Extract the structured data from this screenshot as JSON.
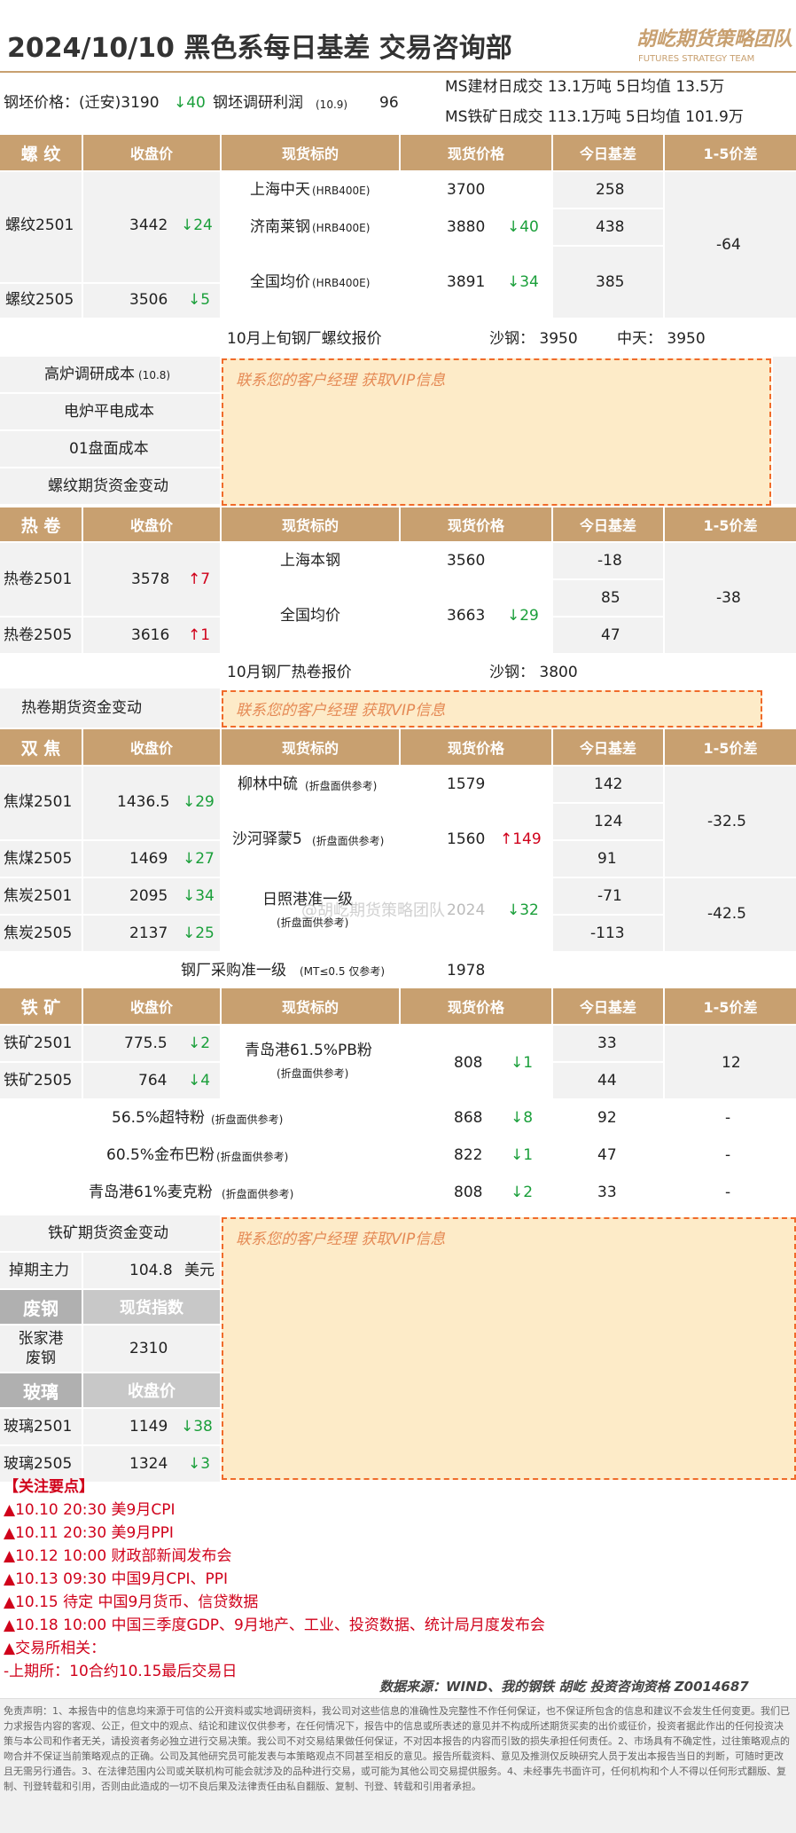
{
  "header": {
    "title": "2024/10/10  黑色系每日基差    交易咨询部",
    "logo_cn": "胡屹期货策略团队",
    "logo_en": "FUTURES STRATEGY TEAM"
  },
  "topinfo": {
    "billet_label": "钢坯价格：(迁安)3190",
    "billet_chg": "↓40",
    "profit_label": "钢坯调研利润",
    "profit_date": "(10.9)",
    "profit_val": "96",
    "ms1": "MS建材日成交  13.1万吨    5日均值  13.5万",
    "ms2": "MS铁矿日成交  113.1万吨   5日均值 101.9万"
  },
  "cols": {
    "close": "收盘价",
    "spot": "现货标的",
    "spot_price": "现货价格",
    "basis": "今日基差",
    "spread": "1-5价差"
  },
  "rebar": {
    "head": "螺 纹",
    "r1": {
      "name": "螺纹2501",
      "close": "3442",
      "chg": "↓24"
    },
    "r2": {
      "name": "螺纹2505",
      "close": "3506",
      "chg": "↓5"
    },
    "s1": {
      "name": "上海中天",
      "spec": "(HRB400E)",
      "price": "3700",
      "chg": "",
      "basis": "258"
    },
    "s2": {
      "name": "济南莱钢",
      "spec": "(HRB400E)",
      "price": "3880",
      "chg": "↓40",
      "basis": "438"
    },
    "s3": {
      "name": "全国均价",
      "spec": "(HRB400E)",
      "price": "3891",
      "chg": "↓34",
      "basis": "385"
    },
    "spread": "-64",
    "quote_title": "10月上旬钢厂螺纹报价",
    "q1": "沙钢：  3950",
    "q2": "中天：  3950"
  },
  "rebar_cost": {
    "c1": "高炉调研成本",
    "c1d": "(10.8)",
    "c2": "电炉平电成本",
    "c3": "01盘面成本",
    "c4": "螺纹期货资金变动"
  },
  "vip": "联系您的客户经理     获取VIP信息",
  "hrc": {
    "head": "热 卷",
    "r1": {
      "name": "热卷2501",
      "close": "3578",
      "chg": "↑7"
    },
    "r2": {
      "name": "热卷2505",
      "close": "3616",
      "chg": "↑1"
    },
    "s1": {
      "name": "上海本钢",
      "price": "3560",
      "basis": "-18"
    },
    "basis2": "85",
    "s2": {
      "name": "全国均价",
      "price": "3663",
      "chg": "↓29",
      "basis": "47"
    },
    "spread": "-38",
    "quote_title": "10月钢厂热卷报价",
    "q1": "沙钢：  3800",
    "flow": "热卷期货资金变动"
  },
  "coke": {
    "head": "双 焦",
    "r1": {
      "name": "焦煤2501",
      "close": "1436.5",
      "chg": "↓29"
    },
    "r2": {
      "name": "焦煤2505",
      "close": "1469",
      "chg": "↓27"
    },
    "r3": {
      "name": "焦炭2501",
      "close": "2095",
      "chg": "↓34"
    },
    "r4": {
      "name": "焦炭2505",
      "close": "2137",
      "chg": "↓25"
    },
    "s1": {
      "name": "柳林中硫",
      "note": "(折盘面供参考)",
      "price": "1579",
      "basis": "142"
    },
    "s2": {
      "name": "沙河驿蒙5",
      "note": "(折盘面供参考)",
      "price": "1560",
      "chg": "↑149",
      "basis1": "124",
      "basis2": "91"
    },
    "s3": {
      "name": "日照港准一级",
      "note": "(折盘面供参考)",
      "price": "2024",
      "chg": "↓32",
      "basis1": "-71",
      "basis2": "-113"
    },
    "spread1": "-32.5",
    "spread2": "-42.5",
    "mill": "钢厂采购准一级",
    "mill_note": "(MT≤0.5 仅参考)",
    "mill_price": "1978",
    "watermark": "@胡屹期货策略团队"
  },
  "ore": {
    "head": "铁 矿",
    "r1": {
      "name": "铁矿2501",
      "close": "775.5",
      "chg": "↓2"
    },
    "r2": {
      "name": "铁矿2505",
      "close": "764",
      "chg": "↓4"
    },
    "s1": {
      "name": "青岛港61.5%PB粉",
      "note": "(折盘面供参考)",
      "price": "808",
      "chg": "↓1",
      "basis1": "33",
      "basis2": "44"
    },
    "spread": "12",
    "e1": {
      "name": "56.5%超特粉",
      "note": "(折盘面供参考)",
      "price": "868",
      "chg": "↓8",
      "basis": "92",
      "spread": "-"
    },
    "e2": {
      "name": "60.5%金布巴粉",
      "note": "(折盘面供参考)",
      "price": "822",
      "chg": "↓1",
      "basis": "47",
      "spread": "-"
    },
    "e3": {
      "name": "青岛港61%麦克粉",
      "note": "(折盘面供参考)",
      "price": "808",
      "chg": "↓2",
      "basis": "33",
      "spread": "-"
    },
    "flow": "铁矿期货资金变动",
    "swap_label": "掉期主力",
    "swap_val": "104.8",
    "swap_unit": "美元"
  },
  "scrap": {
    "head": "废钢",
    "col": "现货指数",
    "name": "张家港废钢",
    "val": "2310"
  },
  "glass": {
    "head": "玻璃",
    "col": "收盘价",
    "r1": {
      "name": "玻璃2501",
      "close": "1149",
      "chg": "↓38"
    },
    "r2": {
      "name": "玻璃2505",
      "close": "1324",
      "chg": "↓3"
    }
  },
  "focus": {
    "title": "【关注要点】",
    "items": [
      "▲10.10 20:30 美9月CPI",
      "▲10.11 20:30 美9月PPI",
      "▲10.12 10:00 财政部新闻发布会",
      "▲10.13 09:30 中国9月CPI、PPI",
      "▲10.15 待定 中国9月货币、信贷数据",
      "▲10.18 10:00 中国三季度GDP、9月地产、工业、投资数据、统计局月度发布会",
      "▲交易所相关：",
      "-上期所：10合约10.15最后交易日"
    ]
  },
  "source": "数据来源：WIND、我的钢铁      胡屹  投资咨询资格 Z0014687",
  "disclaimer": "免责声明：1、本报告中的信息均来源于可信的公开资料或实地调研资料，我公司对这些信息的准确性及完整性不作任何保证，也不保证所包含的信息和建议不会发生任何变更。我们已力求报告内容的客观、公正，但文中的观点、结论和建议仅供参考，在任何情况下，报告中的信息或所表述的意见并不构成所述期货买卖的出价或征价，投资者据此作出的任何投资决策与本公司和作者无关，请投资者务必独立进行交易决策。我公司不对交易结果做任何保证，不对因本报告的内容而引致的损失承担任何责任。2、市场具有不确定性，过往策略观点的吻合并不保证当前策略观点的正确。公司及其他研究员可能发表与本策略观点不同甚至相反的意见。报告所载资料、意见及推测仅反映研究人员于发出本报告当日的判断，可随时更改且无需另行通告。3、在法律范围内公司或关联机构可能会就涉及的品种进行交易，或可能为其他公司交易提供服务。4、未经事先书面许可，任何机构和个人不得以任何形式翻版、复制、刊登转载和引用，否则由此造成的一切不良后果及法律责任由私自翻版、复制、刊登、转载和引用者承担。"
}
